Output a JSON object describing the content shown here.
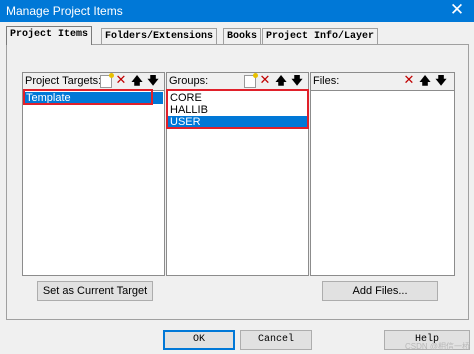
{
  "window": {
    "title": "Manage Project Items",
    "close_glyph": "✕"
  },
  "tabs": [
    {
      "label": "Project Items",
      "active": true
    },
    {
      "label": "Folders/Extensions",
      "active": false
    },
    {
      "label": "Books",
      "active": false
    },
    {
      "label": "Project Info/Layer",
      "active": false
    }
  ],
  "targets": {
    "label": "Project Targets:",
    "items": [
      {
        "label": "Template",
        "selected": true
      }
    ],
    "toolbar_icons": [
      "new-icon",
      "delete-icon",
      "move-up-icon",
      "move-down-icon"
    ]
  },
  "groups": {
    "label": "Groups:",
    "items": [
      {
        "label": "CORE",
        "selected": false
      },
      {
        "label": "HALLIB",
        "selected": false
      },
      {
        "label": "USER",
        "selected": true
      }
    ],
    "toolbar_icons": [
      "new-icon",
      "delete-icon",
      "move-up-icon",
      "move-down-icon"
    ]
  },
  "files": {
    "label": "Files:",
    "items": [],
    "toolbar_icons": [
      "delete-icon",
      "move-up-icon",
      "move-down-icon"
    ]
  },
  "buttons": {
    "set_current_target": "Set as Current Target",
    "add_files": "Add Files...",
    "ok": "OK",
    "cancel": "Cancel",
    "help": "Help"
  },
  "toolbar_glyphs": {
    "delete": "✕",
    "up": "🡅",
    "down": "🡇"
  },
  "colors": {
    "selection": "#0078d7",
    "highlight_box": "#e0202a",
    "titlebar": "#0078d7"
  },
  "watermark": "CSDN @相信一桥"
}
